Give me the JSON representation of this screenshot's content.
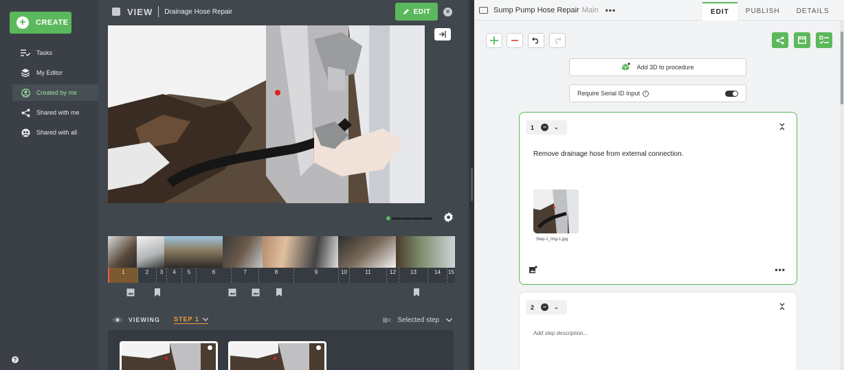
{
  "sidebar": {
    "create_label": "CREATE",
    "items": [
      {
        "label": "Tasks",
        "icon": "tasks-icon"
      },
      {
        "label": "My Editor",
        "icon": "editor-icon"
      },
      {
        "label": "Created by me",
        "icon": "user-icon"
      },
      {
        "label": "Shared with me",
        "icon": "share-icon"
      },
      {
        "label": "Shared with all",
        "icon": "globe-icon"
      }
    ],
    "active_index": 2,
    "help": "?"
  },
  "center": {
    "view_label": "VIEW",
    "title": "Drainage Hose Repair",
    "edit_label": "EDIT",
    "timeline_steps": [
      "1",
      "2",
      "3",
      "4",
      "5",
      "6",
      "7",
      "8",
      "9",
      "10",
      "11",
      "12",
      "13",
      "14",
      "15"
    ],
    "viewing_label": "VIEWING",
    "step_selector": "STEP 1",
    "selected_step_label": "Selected step"
  },
  "right": {
    "procedure_title": "Sump Pump Hose Repair",
    "branch": "Main",
    "tabs": [
      "EDIT",
      "PUBLISH",
      "DETAILS"
    ],
    "active_tab": 0,
    "add_3d_label": "Add 3D to procedure",
    "serial_label": "Require Serial ID Input",
    "steps": [
      {
        "number": "1",
        "description": "Remove drainage hose from external connection.",
        "image_name": "Step-1_Img-1.jpg"
      },
      {
        "number": "2",
        "placeholder": "Add step description..."
      }
    ]
  },
  "colors": {
    "accent": "#5cb85c",
    "step_orange": "#f0a040",
    "danger": "#d9534f"
  }
}
